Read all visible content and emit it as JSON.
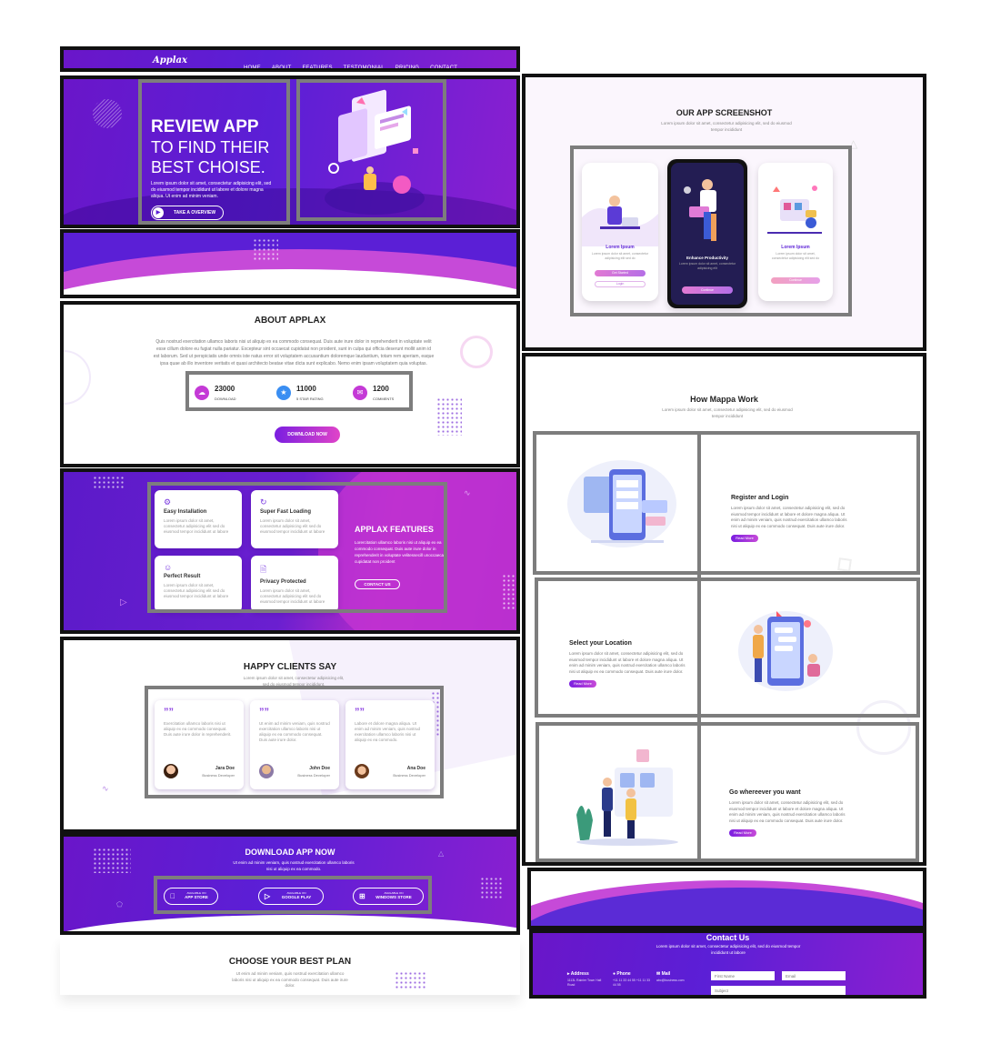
{
  "header": {
    "logo": "Applax",
    "nav": [
      "HOME",
      "ABOUT",
      "FEATURES",
      "TESTOMONIAL",
      "PRICING",
      "CONTACT"
    ]
  },
  "hero": {
    "title_line1": "REVIEW APP",
    "title_line2": "TO FIND THEIR",
    "title_line3": "BEST CHOISE.",
    "body": "Lorem ipsum dolor sit amet, consectetur adipisicing elit, sed do eiusmod tempor incididunt ut labore et dolore magna aliqua. Ut enim ad minim veniam.",
    "cta": "TAKE A OVERVIEW"
  },
  "about": {
    "title": "ABOUT APPLAX",
    "body": "Quis nostrud exercitation ullamco laboris nisi ut aliquip ex ea commodo consequat. Duis aute irure dolor in reprehenderit in voluptate velit esse cillum dolore eu fugiat nulla pariatur. Excepteur sint occaecat cupidatat non proident, sunt in culpa qui officia deserunt mollit anim id est laborum. Sed ut perspiciatis unde omnis iste natus error sit voluptatem accusantium doloremque laudantium, totam rem aperiam, eaque ipsa quae ab illo inventore veritatis et quasi architecto beatae vitae dicta sunt explicabo. Nemo enim ipsam voluptatem quia voluptas.",
    "stats": [
      {
        "value": "23000",
        "label": "DOWNLOAD"
      },
      {
        "value": "11000",
        "label": "5 STAR RATING"
      },
      {
        "value": "1200",
        "label": "COMMENTS"
      }
    ],
    "button": "DOWNLOAD NOW"
  },
  "features": {
    "title": "APPLAX FEATURES",
    "body": "Lorercitation ullamco laboris nisi ut aliquip ex ea commodo consequat. Duis aute irure dolor in reprehenderit in voluptate velitessecill unoccaecat cupidatat non proident",
    "button": "CONTACT US",
    "cards": [
      {
        "title": "Easy Installation",
        "text": "Lorem ipsum dolor sit amet, consectetur adipisicing elit sed do eiusmod tempor incididunt ut labore"
      },
      {
        "title": "Super Fast Loading",
        "text": "Lorem ipsum dolor sit amet, consectetur adipisicing elit sed do eiusmod tempor incididunt ut labore"
      },
      {
        "title": "Perfect Result",
        "text": "Lorem ipsum dolor sit amet, consectetur adipisicing elit sed do eiusmod tempor incididunt ut labore"
      },
      {
        "title": "Privacy Protected",
        "text": "Lorem ipsum dolor sit amet, consectetur adipisicing elit sed do eiusmod tempor incididunt ut labore"
      }
    ]
  },
  "testimonials": {
    "title": "HAPPY CLIENTS SAY",
    "subtitle": "Lorem ipsum dolor sit amet, consectetur adipisicing elit, sed do eiusmod tempor incididunt.",
    "items": [
      {
        "text": "Exercitation ullamco laboris nisi ut aliquip ex ea commodo consequat. Duis aute irure dolor in reprehenderit.",
        "name": "Jara Doe",
        "role": "Business Developer"
      },
      {
        "text": "Ut enim ad minim veniam, quis nostrud exercitation ullamco laboris nisi ut aliquip ex ea commodo consequat. Duis aute irure dolor.",
        "name": "John Doe",
        "role": "Business Developer"
      },
      {
        "text": "Labore et dolore magna aliqua. Ut enim ad minim veniam, quis nostrud exercitation ullamco laboris nisi ut aliquip ex ea commodo.",
        "name": "Ana Doe",
        "role": "Business Developer"
      }
    ]
  },
  "download": {
    "title": "DOWNLOAD  APP NOW",
    "subtitle": "Ut enim ad minim veniam, quis nostrud exercitation ullamco laboris nisi ut aliquip ex ea commodo.",
    "stores": [
      {
        "small": "AVAILABLE ON",
        "name": "APP STORE"
      },
      {
        "small": "AVAILABLE ON",
        "name": "GOOGLE PLAY"
      },
      {
        "small": "AVAILABLE ON",
        "name": "WINDOWS STORE"
      }
    ]
  },
  "pricing": {
    "title": "CHOOSE YOUR BEST PLAN",
    "subtitle": "Ut enim ad minim veniam, quis nostrud exercitation ullamco laboris nisi ut aliquip ex ea commodo consequat. Duis aute irure dolor."
  },
  "screenshots": {
    "title": "OUR APP SCREENSHOT",
    "subtitle": "Lorem ipsum dolor sit amet, consectetur adipisicing elit, sed do eiusmod tempor incididunt",
    "phones": [
      {
        "heading": "Lorem Ipsum",
        "text": "Lorem ipsum dolor sit amet, consectetur adipisicing elit sed do",
        "btn1": "Get Started",
        "btn2": "Login"
      },
      {
        "heading": "Enhance Productivity",
        "text": "Lorem ipsum dolor sit amet, consectetur adipisicing elit",
        "btn1": "Continue"
      },
      {
        "heading": "Lorem Ipsum",
        "text": "Lorem ipsum dolor sit amet, consectetur adipisicing elit sed do",
        "btn1": "Continue"
      }
    ]
  },
  "how": {
    "title": "How Mappa Work",
    "subtitle": "Lorem ipsum dolor sit amet, consectetur adipisicing elit, sed do eiusmod tempor incididunt",
    "steps": [
      {
        "title": "Register and Login",
        "text": "Lorem ipsum dolor sit amet, consectetur adipisicing elit, sed do eiusmod tempor incididunt ut labore et dolore magna aliqua. Ut enim ad minim veniam, quis nostrud exercitation ullamco laboris nisi ut aliquip ex ea commodo consequat. Duis aute irure dolor.",
        "button": "Read More"
      },
      {
        "title": "Select your Location",
        "text": "Lorem ipsum dolor sit amet, consectetur adipisicing elit, sed do eiusmod tempor incididunt ut labore et dolore magna aliqua. Ut enim ad minim veniam, quis nostrud exercitation ullamco laboris nisi ut aliquip ex ea commodo consequat. Duis aute irure dolor.",
        "button": "Read More"
      },
      {
        "title": "Go whereever you want",
        "text": "Lorem ipsum dolor sit amet, consectetur adipisicing elit, sed do eiusmod tempor incididunt ut labore et dolore magna aliqua. Ut enim ad minim veniam, quis nostrud exercitation ullamco laboris nisi ut aliquip ex ea commodo consequat. Duis aute irure dolor.",
        "button": "Read More"
      }
    ]
  },
  "contact": {
    "title": "Contact Us",
    "subtitle": "Lorem ipsum dolor sit amet, consectetur adipisicing elit, sed do eiusmod tempor incididunt ut labore",
    "address_label": "Address",
    "address_value": "1113L Rainier Town Hall Road",
    "phone_label": "Phone",
    "phone_value": "+11 11 33 44 55 +11 11 33 44 55",
    "mail_label": "Mail",
    "mail_value": "abc@business.com",
    "first_name_placeholder": "First Name",
    "email_placeholder": "Email",
    "subject_placeholder": "Subject"
  },
  "colors": {
    "primary": "#5b1fd6",
    "accent": "#c64ad8",
    "frame": "#111111",
    "highlight_box": "#7d7d7d"
  }
}
